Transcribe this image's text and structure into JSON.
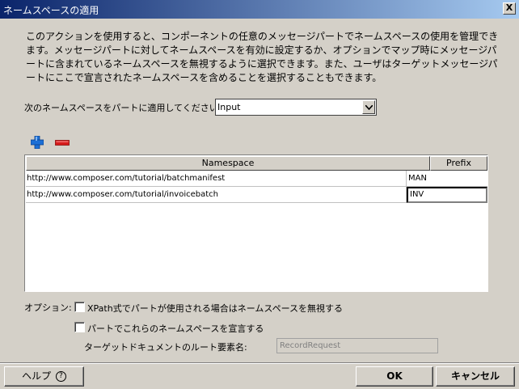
{
  "window": {
    "title": "ネームスペースの適用",
    "close_glyph": "X"
  },
  "description": "このアクションを使用すると、コンポーネントの任意のメッセージパートでネームスペースの使用を管理できます。メッセージパートに対してネームスペースを有効に設定するか、オプションでマップ時にメッセージパートに含まれているネームスペースを無視するように選択できます。また、ユーザはターゲットメッセージパートにここで宣言されたネームスペースを含めることを選択することもできます。",
  "apply_part": {
    "label": "次のネームスペースをパートに適用してください",
    "selected": "Input"
  },
  "toolbar": {
    "add_icon": "add-icon",
    "remove_icon": "remove-icon"
  },
  "table": {
    "columns": [
      "Namespace",
      "Prefix"
    ],
    "rows": [
      {
        "namespace": "http://www.composer.com/tutorial/batchmanifest",
        "prefix": "MAN"
      },
      {
        "namespace": "http://www.composer.com/tutorial/invoicebatch",
        "prefix": "INV"
      }
    ]
  },
  "options": {
    "label": "オプション:",
    "ignore_xpath": {
      "label": "XPath式でパートが使用される場合はネームスペースを無視する",
      "checked": false
    },
    "declare_in_part": {
      "label": "パートでこれらのネームスペースを宣言する",
      "checked": false
    },
    "root_element": {
      "label": "ターゲットドキュメントのルート要素名:",
      "value": "RecordRequest"
    }
  },
  "buttons": {
    "help": "ヘルプ",
    "help_glyph": "?",
    "ok": "OK",
    "cancel": "キャンセル"
  }
}
